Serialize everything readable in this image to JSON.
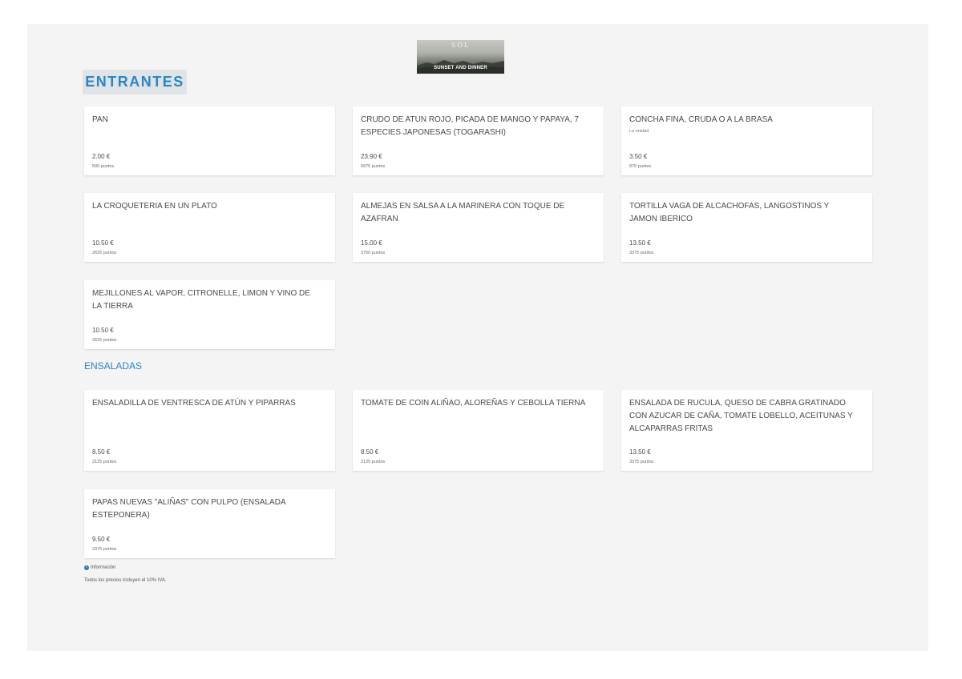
{
  "logo": {
    "top_text": "SOL",
    "bottom_text": "SUNSET AND DINNER"
  },
  "section": {
    "title": "ENTRANTES",
    "items": [
      {
        "name": "PAN",
        "desc": "",
        "price": "2.00 €",
        "points": "500 puntos"
      },
      {
        "name": "CRUDO DE ATUN ROJO, PICADA DE MANGO Y PAPAYA, 7 ESPECIES JAPONESAS (TOGARASHI)",
        "desc": "",
        "price": "23.90 €",
        "points": "5975 puntos"
      },
      {
        "name": "CONCHA FINA, CRUDA O A LA BRASA",
        "desc": "La unidad",
        "price": "3.50 €",
        "points": "875 puntos"
      },
      {
        "name": "LA CROQUETERIA EN UN PLATO",
        "desc": "",
        "price": "10.50 €",
        "points": "2625 puntos"
      },
      {
        "name": "ALMEJAS EN SALSA A LA MARINERA CON TOQUE DE AZAFRAN",
        "desc": "",
        "price": "15.00 €",
        "points": "3750 puntos"
      },
      {
        "name": "TORTILLA VAGA DE ALCACHOFAS, LANGOSTINOS Y JAMON IBERICO",
        "desc": "",
        "price": "13.50 €",
        "points": "3375 puntos"
      },
      {
        "name": "MEJILLONES AL VAPOR, CITRONELLE, LIMON Y VINO DE LA TIERRA",
        "desc": "",
        "price": "10.50 €",
        "points": "2625 puntos"
      }
    ]
  },
  "subsection": {
    "title": "ENSALADAS",
    "items": [
      {
        "name": "ENSALADILLA DE VENTRESCA DE ATÚN Y PIPARRAS",
        "desc": "",
        "price": "8.50 €",
        "points": "2125 puntos"
      },
      {
        "name": "TOMATE DE COIN ALIÑAO, ALOREÑAS Y CEBOLLA TIERNA",
        "desc": "",
        "price": "8.50 €",
        "points": "2125 puntos"
      },
      {
        "name": "ENSALADA DE RUCULA, QUESO DE CABRA GRATINADO CON AZUCAR DE CAÑA, TOMATE LOBELLO, ACEITUNAS Y ALCAPARRAS FRITAS",
        "desc": "",
        "price": "13.50 €",
        "points": "3375 puntos"
      },
      {
        "name": "PAPAS NUEVAS \"ALIÑAS\" CON PULPO (ENSALADA ESTEPONERA)",
        "desc": "",
        "price": "9.50 €",
        "points": "2375 puntos"
      }
    ]
  },
  "footer": {
    "info_label": "Información",
    "info_icon": "info-icon",
    "vat_note": "Todos los precios incluyen el 10% IVA."
  },
  "colors": {
    "accent": "#2a86c8",
    "panel_bg": "#f4f4f4",
    "card_bg": "#ffffff"
  }
}
